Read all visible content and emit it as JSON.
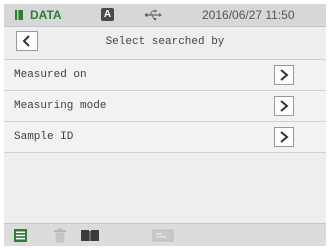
{
  "status_bar": {
    "app_label": "DATA",
    "mode_badge": "A",
    "datetime": "2016/06/27 11:50"
  },
  "title_bar": {
    "title": "Select searched by"
  },
  "search_options": [
    {
      "label": "Measured on"
    },
    {
      "label": "Measuring mode"
    },
    {
      "label": "Sample ID"
    }
  ],
  "toolbar": {
    "icons": [
      "list-icon",
      "trash-icon",
      "book-icon",
      "card-icon"
    ]
  },
  "colors": {
    "accent": "#2e7d32",
    "screen_bg": "#eeeeee",
    "status_bg": "#d7d7d7"
  }
}
